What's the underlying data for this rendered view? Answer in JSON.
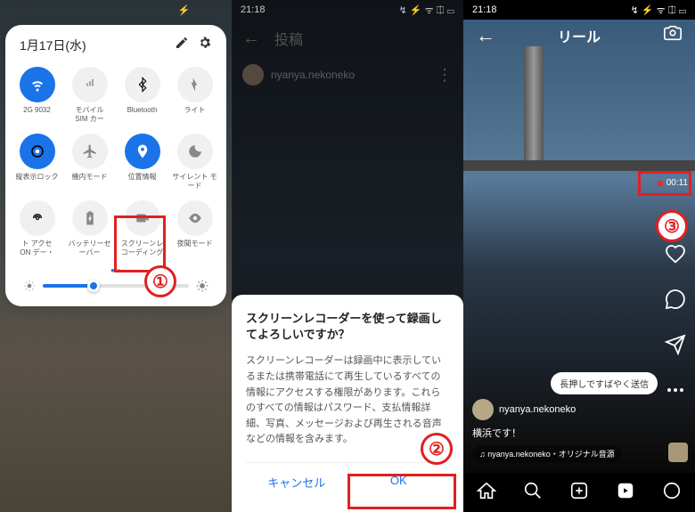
{
  "status": {
    "time": "21:18",
    "icons": "↯ ⚡ ᯤ ⎅ ▭"
  },
  "screen1": {
    "date": "1月17日(水)",
    "tiles": [
      {
        "label": "2G  9032",
        "on": true,
        "icon": "wifi"
      },
      {
        "label": "モバイル\nSIM カー",
        "on": false,
        "icon": "mobile"
      },
      {
        "label": "Bluetooth",
        "on": false,
        "icon": "bt"
      },
      {
        "label": "ライト",
        "on": false,
        "icon": "flash"
      },
      {
        "label": "縦表示ロック",
        "on": true,
        "icon": "lock"
      },
      {
        "label": "機内モード",
        "on": false,
        "icon": "plane"
      },
      {
        "label": "位置情報",
        "on": true,
        "icon": "loc"
      },
      {
        "label": "サイレント モ\nード",
        "on": false,
        "icon": "moon"
      },
      {
        "label": "ト    アクセ\nON  デー・",
        "on": false,
        "icon": "hotspot"
      },
      {
        "label": "バッテリーセ\nーバー",
        "on": false,
        "icon": "battery"
      },
      {
        "label": "スクリーンレ\nコーディング",
        "on": false,
        "icon": "record"
      },
      {
        "label": "夜間モード",
        "on": false,
        "icon": "eye"
      }
    ]
  },
  "screen2": {
    "header": "投稿",
    "username": "nyanya.nekoneko",
    "dialog": {
      "title": "スクリーンレコーダーを使って録画してよろしいですか？",
      "body": "スクリーンレコーダーは録画中に表示しているまたは携帯電話にて再生しているすべての情報にアクセスする権限があります。これらのすべての情報はパスワード、支払情報詳細、写真、メッセージおよび再生される音声などの情報を含みます。",
      "cancel": "キャンセル",
      "ok": "OK"
    }
  },
  "screen3": {
    "title": "リール",
    "timer": "00:11",
    "tooltip": "長押しですばやく送信",
    "username": "nyanya.nekoneko",
    "caption": "横浜です！",
    "audio": "♫ nyanya.nekoneko・オリジナル音源"
  },
  "annotations": {
    "n1": "①",
    "n2": "②",
    "n3": "③"
  }
}
